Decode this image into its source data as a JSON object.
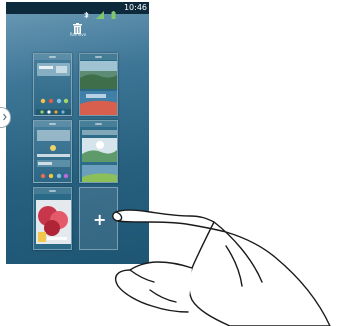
{
  "status_bar": {
    "time": "10:46",
    "icons": [
      "bluetooth-icon",
      "signal-icon",
      "battery-icon"
    ]
  },
  "toolbar": {
    "remove_label": "Remove",
    "remove_icon": "trash-icon"
  },
  "panels": {
    "count": 5,
    "add_panel_icon": "+"
  },
  "colors": {
    "wallpaper": "#2d6a8c",
    "status_bar": "#0c2a3b",
    "hand_outline": "#1a1a1a"
  }
}
